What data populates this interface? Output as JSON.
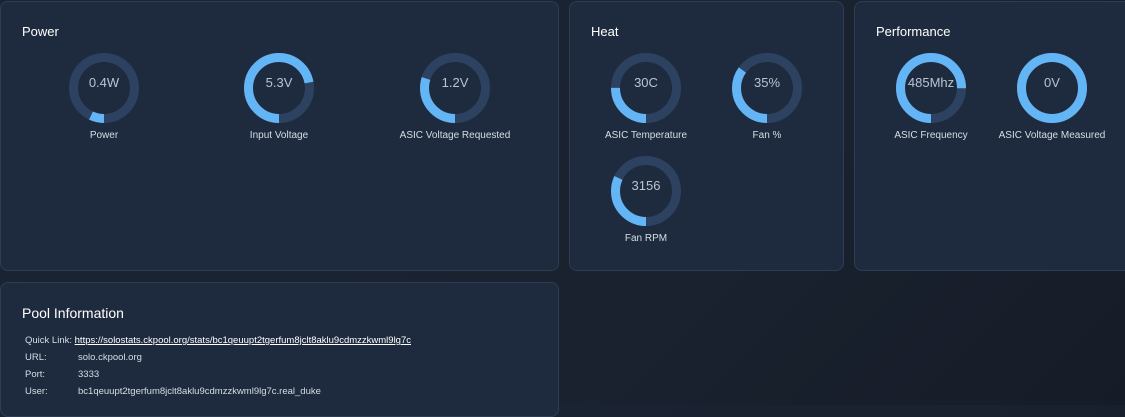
{
  "power": {
    "title": "Power",
    "gauges": [
      {
        "value": "0.4W",
        "label": "Power",
        "fill": 0.07
      },
      {
        "value": "5.3V",
        "label": "Input Voltage",
        "fill": 0.72
      },
      {
        "value": "1.2V",
        "label": "ASIC Voltage Requested",
        "fill": 0.3
      }
    ]
  },
  "heat": {
    "title": "Heat",
    "gauges": [
      {
        "value": "30C",
        "label": "ASIC Temperature",
        "fill": 0.25
      },
      {
        "value": "35%",
        "label": "Fan %",
        "fill": 0.35
      },
      {
        "value": "3156",
        "label": "Fan RPM",
        "fill": 0.32
      }
    ]
  },
  "performance": {
    "title": "Performance",
    "gauges": [
      {
        "value": "485Mhz",
        "label": "ASIC Frequency",
        "fill": 0.75
      },
      {
        "value": "0V",
        "label": "ASIC Voltage Measured",
        "fill": 1.0
      }
    ]
  },
  "pool": {
    "title": "Pool Information",
    "quick_link_key": "Quick Link:",
    "quick_link": "https://solostats.ckpool.org/stats/bc1qeuupt2tgerfum8jclt8aklu9cdmzzkwml9lg7c",
    "url_key": "URL:",
    "url": "solo.ckpool.org",
    "port_key": "Port:",
    "port": "3333",
    "user_key": "User:",
    "user": "bc1qeuupt2tgerfum8jclt8aklu9cdmzzkwml9lg7c.real_duke"
  },
  "colors": {
    "track": "#2d4260",
    "fill": "#64b5f6",
    "card": "#1e2b3e"
  }
}
